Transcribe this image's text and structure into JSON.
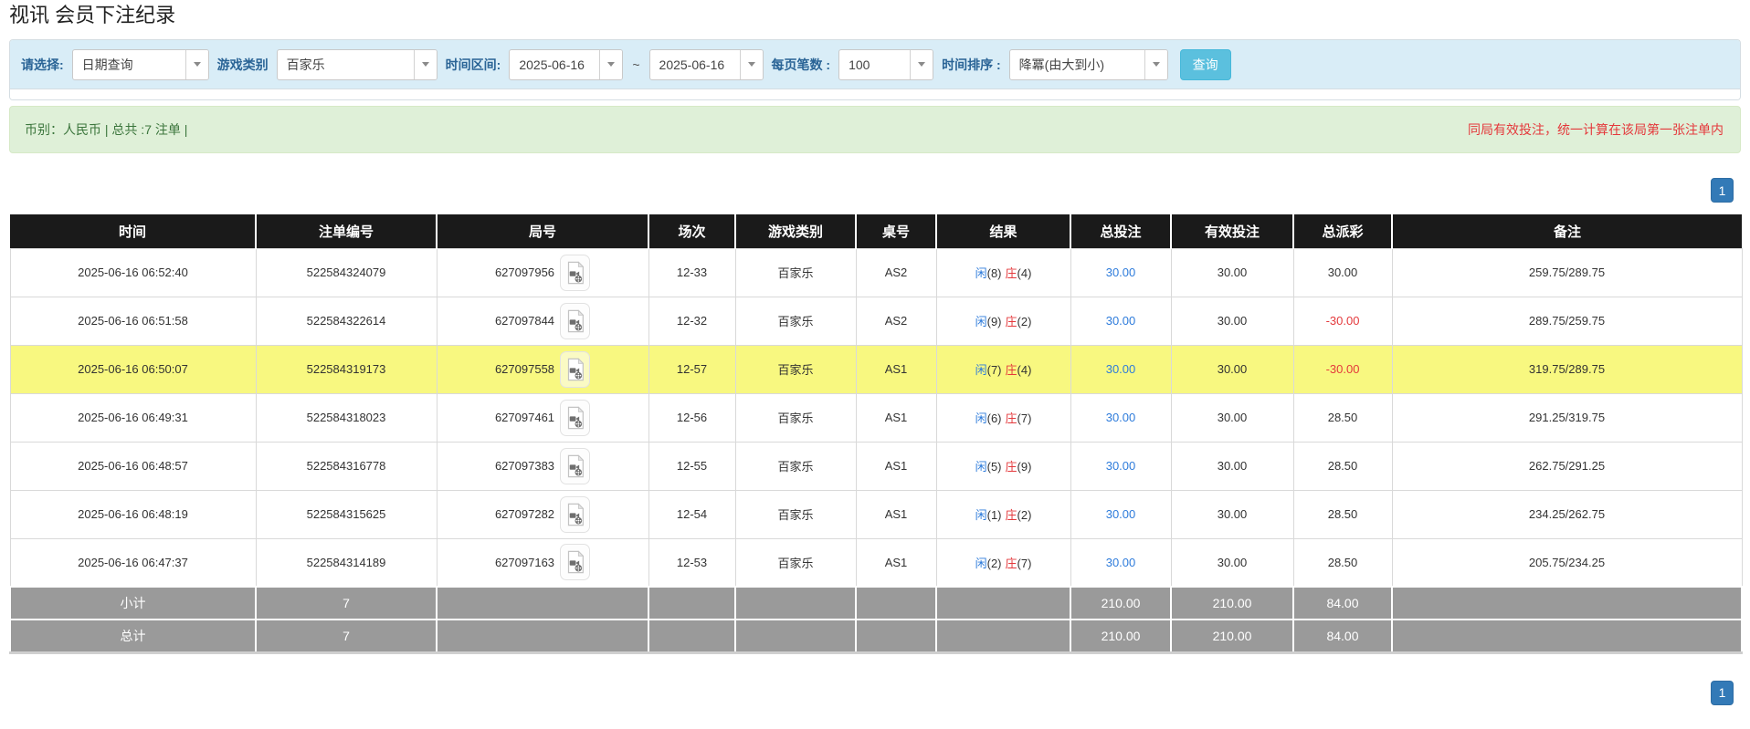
{
  "title": "视讯 会员下注纪录",
  "filter_bar": {
    "select_type_label": "请选择:",
    "select_type_value": "日期查询",
    "game_label": "游戏类别",
    "game_value": "百家乐",
    "range_label": "时间区间:",
    "range_from": "2025-06-16",
    "range_tilde": "~",
    "range_to": "2025-06-16",
    "page_size_label": "每页笔数 :",
    "page_size_value": "100",
    "sort_label": "时间排序 :",
    "sort_value": "降冪(由大到小)",
    "search_button": "查询"
  },
  "summary_bar": {
    "currency_text": "币别：人民币 | 总共 :7 注单 |",
    "notice_text": "同局有效投注，统一计算在该局第一张注单内"
  },
  "pagination": {
    "top_page": "1",
    "bottom_page": "1"
  },
  "table": {
    "headers": [
      "时间",
      "注单编号",
      "局号",
      "场次",
      "游戏类别",
      "桌号",
      "结果",
      "总投注",
      "有效投注",
      "总派彩",
      "备注"
    ],
    "rows": [
      {
        "time": "2025-06-16 06:52:40",
        "bet_no": "522584324079",
        "round_no": "627097956",
        "session": "12-33",
        "game": "百家乐",
        "table_no": "AS2",
        "result": {
          "player": "闲",
          "player_pts": "(8)",
          "banker": "庄",
          "banker_pts": "(4)"
        },
        "total_bet": "30.00",
        "valid_bet": "30.00",
        "payout": "30.00",
        "remark": "259.75/289.75",
        "highlighted": false
      },
      {
        "time": "2025-06-16 06:51:58",
        "bet_no": "522584322614",
        "round_no": "627097844",
        "session": "12-32",
        "game": "百家乐",
        "table_no": "AS2",
        "result": {
          "player": "闲",
          "player_pts": "(9)",
          "banker": "庄",
          "banker_pts": "(2)"
        },
        "total_bet": "30.00",
        "valid_bet": "30.00",
        "payout": "-30.00",
        "remark": "289.75/259.75",
        "highlighted": false
      },
      {
        "time": "2025-06-16 06:50:07",
        "bet_no": "522584319173",
        "round_no": "627097558",
        "session": "12-57",
        "game": "百家乐",
        "table_no": "AS1",
        "result": {
          "player": "闲",
          "player_pts": "(7)",
          "banker": "庄",
          "banker_pts": "(4)"
        },
        "total_bet": "30.00",
        "valid_bet": "30.00",
        "payout": "-30.00",
        "remark": "319.75/289.75",
        "highlighted": true
      },
      {
        "time": "2025-06-16 06:49:31",
        "bet_no": "522584318023",
        "round_no": "627097461",
        "session": "12-56",
        "game": "百家乐",
        "table_no": "AS1",
        "result": {
          "player": "闲",
          "player_pts": "(6)",
          "banker": "庄",
          "banker_pts": "(7)"
        },
        "total_bet": "30.00",
        "valid_bet": "30.00",
        "payout": "28.50",
        "remark": "291.25/319.75",
        "highlighted": false
      },
      {
        "time": "2025-06-16 06:48:57",
        "bet_no": "522584316778",
        "round_no": "627097383",
        "session": "12-55",
        "game": "百家乐",
        "table_no": "AS1",
        "result": {
          "player": "闲",
          "player_pts": "(5)",
          "banker": "庄",
          "banker_pts": "(9)"
        },
        "total_bet": "30.00",
        "valid_bet": "30.00",
        "payout": "28.50",
        "remark": "262.75/291.25",
        "highlighted": false
      },
      {
        "time": "2025-06-16 06:48:19",
        "bet_no": "522584315625",
        "round_no": "627097282",
        "session": "12-54",
        "game": "百家乐",
        "table_no": "AS1",
        "result": {
          "player": "闲",
          "player_pts": "(1)",
          "banker": "庄",
          "banker_pts": "(2)"
        },
        "total_bet": "30.00",
        "valid_bet": "30.00",
        "payout": "28.50",
        "remark": "234.25/262.75",
        "highlighted": false
      },
      {
        "time": "2025-06-16 06:47:37",
        "bet_no": "522584314189",
        "round_no": "627097163",
        "session": "12-53",
        "game": "百家乐",
        "table_no": "AS1",
        "result": {
          "player": "闲",
          "player_pts": "(2)",
          "banker": "庄",
          "banker_pts": "(7)"
        },
        "total_bet": "30.00",
        "valid_bet": "30.00",
        "payout": "28.50",
        "remark": "205.75/234.25",
        "highlighted": false
      }
    ],
    "footer_rows": [
      {
        "label": "小计",
        "count": "7",
        "total_bet": "210.00",
        "valid_bet": "210.00",
        "payout": "84.00"
      },
      {
        "label": "总计",
        "count": "7",
        "total_bet": "210.00",
        "valid_bet": "210.00",
        "payout": "84.00"
      }
    ]
  },
  "colors": {
    "search_button_blue": "#5bc0de",
    "pagination_blue": "#337ab7",
    "link_blue": "#2d7bdb",
    "negative_red": "#e4393c",
    "notice_red": "#e4393c",
    "summary_bg_green": "#dff0d8",
    "summary_text_green": "#3c763d",
    "filter_bg_blue": "#d9edf7",
    "table_header_black": "#1a1a1a",
    "highlight_yellow": "#f8f880",
    "footer_gray": "#9a9a9a"
  }
}
